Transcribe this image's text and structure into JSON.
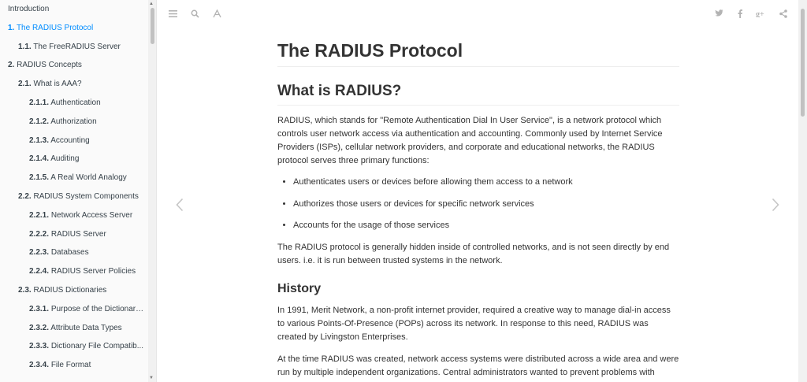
{
  "toc": [
    {
      "num": "",
      "label": "Introduction",
      "level": 0,
      "active": false
    },
    {
      "num": "1.",
      "label": "The RADIUS Protocol",
      "level": 0,
      "active": true
    },
    {
      "num": "1.1.",
      "label": "The FreeRADIUS Server",
      "level": 1,
      "active": false
    },
    {
      "num": "2.",
      "label": "RADIUS Concepts",
      "level": 0,
      "active": false
    },
    {
      "num": "2.1.",
      "label": "What is AAA?",
      "level": 1,
      "active": false
    },
    {
      "num": "2.1.1.",
      "label": "Authentication",
      "level": 2,
      "active": false
    },
    {
      "num": "2.1.2.",
      "label": "Authorization",
      "level": 2,
      "active": false
    },
    {
      "num": "2.1.3.",
      "label": "Accounting",
      "level": 2,
      "active": false
    },
    {
      "num": "2.1.4.",
      "label": "Auditing",
      "level": 2,
      "active": false
    },
    {
      "num": "2.1.5.",
      "label": "A Real World Analogy",
      "level": 2,
      "active": false
    },
    {
      "num": "2.2.",
      "label": "RADIUS System Components",
      "level": 1,
      "active": false
    },
    {
      "num": "2.2.1.",
      "label": "Network Access Server",
      "level": 2,
      "active": false
    },
    {
      "num": "2.2.2.",
      "label": "RADIUS Server",
      "level": 2,
      "active": false
    },
    {
      "num": "2.2.3.",
      "label": "Databases",
      "level": 2,
      "active": false
    },
    {
      "num": "2.2.4.",
      "label": "RADIUS Server Policies",
      "level": 2,
      "active": false
    },
    {
      "num": "2.3.",
      "label": "RADIUS Dictionaries",
      "level": 1,
      "active": false
    },
    {
      "num": "2.3.1.",
      "label": "Purpose of the Dictionaries",
      "level": 2,
      "active": false
    },
    {
      "num": "2.3.2.",
      "label": "Attribute Data Types",
      "level": 2,
      "active": false
    },
    {
      "num": "2.3.3.",
      "label": "Dictionary File Compatib...",
      "level": 2,
      "active": false
    },
    {
      "num": "2.3.4.",
      "label": "File Format",
      "level": 2,
      "active": false
    }
  ],
  "header": {
    "left_icons": [
      "menu-icon",
      "search-icon",
      "font-settings-icon"
    ],
    "right_icons": [
      "twitter-icon",
      "facebook-icon",
      "google-plus-icon",
      "share-icon"
    ]
  },
  "colors": {
    "active_link": "#008cff",
    "icon_gray": "#b3b3b3",
    "text": "#333333"
  },
  "content": {
    "title": "The RADIUS Protocol",
    "section_title": "What is RADIUS?",
    "p1": "RADIUS, which stands for \"Remote Authentication Dial In User Service\", is a network protocol which controls user network access via authentication and accounting. Commonly used by Internet Service Providers (ISPs), cellular network providers, and corporate and educational networks, the RADIUS protocol serves three primary functions:",
    "bullets": [
      "Authenticates users or devices before allowing them access to a network",
      "Authorizes those users or devices for specific network services",
      "Accounts for the usage of those services"
    ],
    "p2": "The RADIUS protocol is generally hidden inside of controlled networks, and is not seen directly by end users. i.e. it is run between trusted systems in the network.",
    "history_title": "History",
    "p3": "In 1991, Merit Network, a non-profit internet provider, required a creative way to manage dial-in access to various Points-Of-Presence (POPs) across its network. In response to this need, RADIUS was created by Livingston Enterprises.",
    "p4": "At the time RADIUS was created, network access systems were distributed across a wide area and were run by multiple independent organizations. Central administrators wanted to prevent problems with"
  }
}
